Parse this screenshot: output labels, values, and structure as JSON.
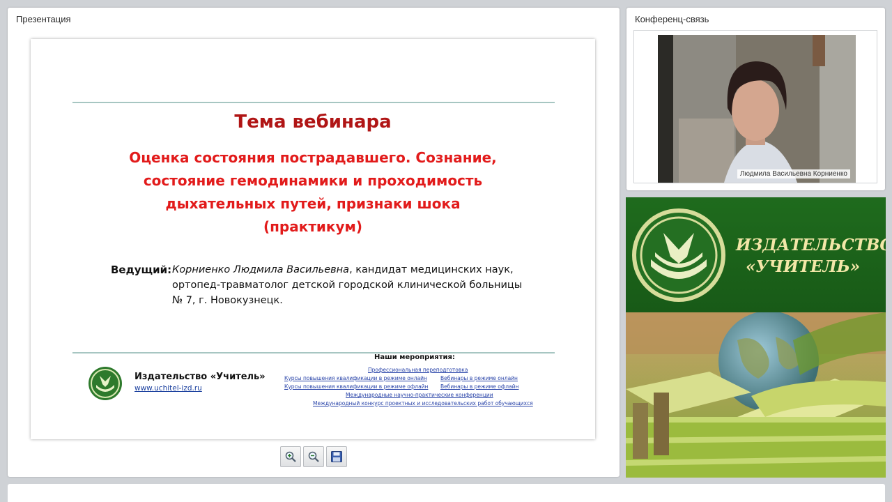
{
  "presentation_panel": {
    "title": "Презентация",
    "slide": {
      "heading": "Тема вебинара",
      "topic_lines": [
        "Оценка состояния пострадавшего. Сознание,",
        "состояние гемодинамики и проходимость",
        "дыхательных путей, признаки шока",
        "(практикум)"
      ],
      "presenter_label": "Ведущий:",
      "presenter_name": "Корниенко Людмила Васильевна",
      "presenter_line1_rest": ", кандидат медицинских наук,",
      "presenter_line2": "ортопед-травматолог детской городской клинической больницы",
      "presenter_line3": "№ 7, г. Новокузнецк.",
      "footer": {
        "publisher_name": "Издательство «Учитель»",
        "publisher_url": "www.uchitel-izd.ru",
        "events_title": "Наши мероприятия:",
        "events": [
          "Профессиональная переподготовка",
          "Курсы повышения квалификации в режиме онлайн",
          "Вебинары в режиме онлайн",
          "Курсы повышения квалификации в режиме офлайн",
          "Вебинары в режиме офлайн",
          "Международные научно-практические конференции",
          "Международный конкурс проектных и исследовательских работ обучающихся"
        ]
      }
    },
    "toolbar": {
      "zoom_in_icon": "zoom-in-icon",
      "zoom_out_icon": "zoom-out-icon",
      "save_icon": "save-icon"
    }
  },
  "conference_panel": {
    "title": "Конференц-связь",
    "participant_name": "Людмила Васильевна Корниенко"
  },
  "banner": {
    "line1": "ИЗДАТЕЛЬСТВО",
    "line2": "«УЧИТЕЛЬ»"
  },
  "colors": {
    "heading": "#b01515",
    "topic": "#e21b1b",
    "rule": "#a7c6c2",
    "banner_green": "#1f6b1d",
    "banner_text": "#f3e7a8",
    "link": "#2843a8"
  }
}
